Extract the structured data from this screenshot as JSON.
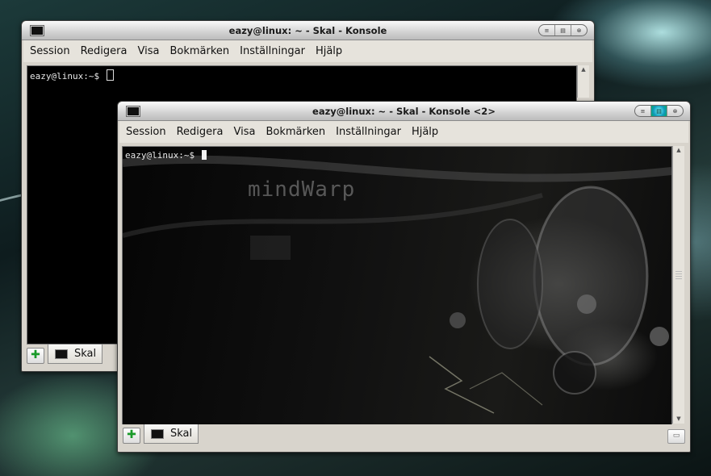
{
  "window_back": {
    "title": "eazy@linux: ~ - Skal - Konsole",
    "menu": [
      "Session",
      "Redigera",
      "Visa",
      "Bokmärken",
      "Inställningar",
      "Hjälp"
    ],
    "prompt": "eazy@linux:~$ ",
    "tab_label": "Skal",
    "title_buttons": [
      "≡",
      "▤",
      "⊗"
    ]
  },
  "window_front": {
    "title": "eazy@linux: ~ - Skal - Konsole <2>",
    "menu": [
      "Session",
      "Redigera",
      "Visa",
      "Bokmärken",
      "Inställningar",
      "Hjälp"
    ],
    "prompt": "eazy@linux:~$ ",
    "tab_label": "Skal",
    "title_buttons": [
      "≡",
      "▤",
      "⊗"
    ],
    "wallpaper_logo": "mindWarp"
  },
  "icons": {
    "title_icon": "terminal-icon",
    "new_tab": "new-tab-icon",
    "close_tab": "close-tab-icon",
    "tab_icon": "terminal-icon"
  },
  "colors": {
    "terminal_bg": "#000000",
    "chrome": "#d8d4cc",
    "active_button": "#19bbcc"
  }
}
